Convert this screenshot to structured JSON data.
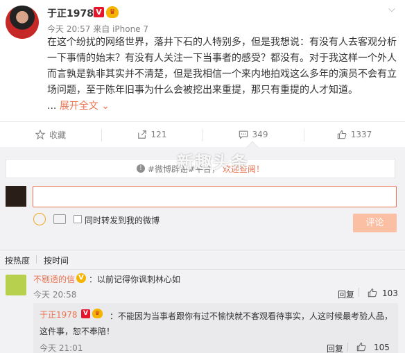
{
  "post": {
    "username": "于正1978",
    "verified_badge": "V",
    "crown_icon": "crown-icon",
    "time": "今天 20:57",
    "source": "来自 iPhone 7",
    "content": "在这个纷扰的网络世界，落井下石的人特别多，但是我想说：有没有人去客观分析一下事情的始末？有没有人关注一下当事者的感受？都没有。对于我这样一个外人而言孰是孰非其实并不清楚，但是我相信一个来内地拍戏这么多年的演员不会有立场问题，至于陈年旧事为什么会被挖出来重提，那只有重提的人才知道。",
    "ellipsis": "...",
    "expand_label": "展开全文",
    "expand_icon": "chevron-down-icon"
  },
  "actions": {
    "favorite_label": "收藏",
    "repost_count": "121",
    "comment_count": "349",
    "like_count": "1337"
  },
  "watermark": "新趣头条",
  "comment_box": {
    "notice_prefix": "#微博辟谣#平台，",
    "notice_highlight": "欢迎查阅！",
    "input_value": "",
    "forward_label": "同时转发到我的微博",
    "submit_label": "评论"
  },
  "sort": {
    "by_hot": "按热度",
    "by_time": "按时间"
  },
  "comments": [
    {
      "user": "不剔透的信",
      "text": "：以前记得你讽刺林心如",
      "time": "今天 20:58",
      "reply_label": "回复",
      "likes": "103"
    }
  ],
  "reply": {
    "user": "于正1978",
    "text": "：不能因为当事者跟你有过不愉快就不客观看待事实，人这时候最考验人品，这件事，恕不奉陪！",
    "time": "今天 21:01",
    "reply_label": "回复",
    "likes": "105"
  },
  "colors": {
    "accent": "#eb7350",
    "verified": "#e6162d",
    "muted": "#808080",
    "panel_bg": "#f2f2f5"
  }
}
